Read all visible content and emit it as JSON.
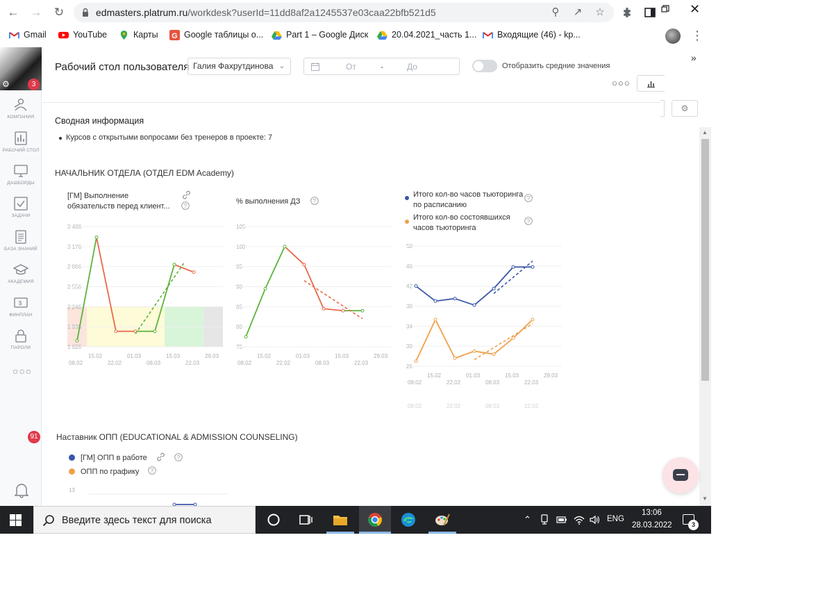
{
  "browser": {
    "url_host": "edmasters.platrum.ru",
    "url_path": "/workdesk?userId=11dd8af2a1245537e03caa22bfb521d5",
    "bookmarks": [
      {
        "label": "Gmail",
        "icon": "gmail-icon"
      },
      {
        "label": "YouTube",
        "icon": "youtube-icon"
      },
      {
        "label": "Карты",
        "icon": "maps-icon"
      },
      {
        "label": "Google таблицы о...",
        "icon": "sheets-icon"
      },
      {
        "label": "Part 1 – Google Диск",
        "icon": "drive-icon"
      },
      {
        "label": "20.04.2021_часть 1...",
        "icon": "drive-icon"
      },
      {
        "label": "Входящие (46) - kp...",
        "icon": "gmail-icon"
      }
    ]
  },
  "sidebar": {
    "avatar_badge": "3",
    "items": [
      {
        "label": "КОМПАНИЯ",
        "icon": "company-icon"
      },
      {
        "label": "РАБОЧИЙ СТОЛ",
        "icon": "workdesk-icon"
      },
      {
        "label": "ДАШБОРДЫ",
        "icon": "dashboard-icon"
      },
      {
        "label": "ЗАДАЧИ",
        "icon": "tasks-icon"
      },
      {
        "label": "БАЗА ЗНАНИЙ",
        "icon": "knowledge-icon"
      },
      {
        "label": "АКАДЕМИЯ",
        "icon": "academy-icon"
      },
      {
        "label": "ФИНПЛАН",
        "icon": "finplan-icon"
      },
      {
        "label": "ПАРОЛИ",
        "icon": "passwords-icon"
      }
    ],
    "notifications_count": "91"
  },
  "header": {
    "title": "Рабочий стол пользователя",
    "user_selected": "Галия Фахрутдинова",
    "date_from_placeholder": "От",
    "date_sep": "-",
    "date_to_placeholder": "До",
    "toggle_label": "Отобразить средние значения"
  },
  "summary": {
    "title": "Сводная информация",
    "item": "Курсов с открытыми вопросами без тренеров в проекте: 7"
  },
  "section1_title": "НАЧАЛЬНИК ОТДЕЛА (ОТДЕЛ EDM Academy)",
  "section2_title": "Наставник ОПП (EDUCATIONAL & ADMISSION COUNSELING)",
  "section2_legend": [
    "[ГМ] ОПП в работе",
    "ОПП по графику"
  ],
  "section2_tick": "13",
  "colors": {
    "green": "#5db33b",
    "red": "#e8694a",
    "blue": "#3a56a8",
    "orange": "#f0a04b",
    "band_green": "#d9f5d9",
    "band_yellow": "#fdfbd8",
    "band_red": "#fbe5dc",
    "band_gray": "#e6e6e6"
  },
  "chart_data": [
    {
      "type": "line",
      "title_lines": [
        "[ГМ] Выполнение",
        "обязательств перед клиент..."
      ],
      "x": [
        "08.02",
        "15.02",
        "22.02",
        "01.03",
        "08.03",
        "15.03",
        "22.03",
        "29.03"
      ],
      "x_ticks_upper": [
        "15.02",
        "01.03",
        "15.03",
        "29.03"
      ],
      "x_ticks_lower": [
        "08.02",
        "22.02",
        "08.03",
        "22.03"
      ],
      "y_ticks": [
        "3 486",
        "3 176",
        "2 866",
        "2 556",
        "2 246",
        "1 936",
        "1 626"
      ],
      "ylim": [
        1626,
        3486
      ],
      "values": [
        1720,
        3320,
        1865,
        1865,
        1865,
        2898,
        2780
      ],
      "trend": [
        [
          3,
          1826
        ],
        [
          5.5,
          2922
        ]
      ],
      "bands": [
        {
          "from": 1626,
          "to": 2246,
          "x0": -0.5,
          "x1": 0.5,
          "color": "band_red"
        },
        {
          "from": 1626,
          "to": 2246,
          "x0": 0.5,
          "x1": 2.5,
          "color": "band_yellow"
        },
        {
          "from": 1626,
          "to": 2246,
          "x0": 2.5,
          "x1": 4.5,
          "color": "band_yellow"
        },
        {
          "from": 1626,
          "to": 2246,
          "x0": 4.5,
          "x1": 6.5,
          "color": "band_green"
        },
        {
          "from": 1626,
          "to": 2246,
          "x0": 6.5,
          "x1": 7.5,
          "color": "band_gray"
        }
      ]
    },
    {
      "type": "line",
      "title_lines": [
        "% выполнения ДЗ"
      ],
      "x": [
        "08.02",
        "15.02",
        "22.02",
        "01.03",
        "08.03",
        "15.03",
        "22.03",
        "29.03"
      ],
      "x_ticks_upper": [
        "15.02",
        "01.03",
        "15.03",
        "29.03"
      ],
      "x_ticks_lower": [
        "08.02",
        "22.02",
        "08.03",
        "22.03"
      ],
      "y_ticks": [
        "105",
        "100",
        "95",
        "90",
        "85",
        "80",
        "75"
      ],
      "ylim": [
        75,
        105
      ],
      "values": [
        77.5,
        89.5,
        100,
        95.5,
        84.5,
        84,
        84
      ],
      "trend": [
        [
          3,
          91.5
        ],
        [
          6,
          82
        ]
      ]
    },
    {
      "type": "line",
      "series": [
        {
          "name": "Итого кол-во часов тьюторинга по расписанию",
          "values": [
            42,
            39,
            39.5,
            38.2,
            41.5,
            45.8,
            45.8
          ],
          "trend": [
            [
              4,
              40.5
            ],
            [
              6,
              47
            ]
          ]
        },
        {
          "name": "Итого кол-во состоявшихся часов тьюторинга",
          "values": [
            27,
            35.3,
            27.6,
            29,
            28.4,
            31.6,
            35.3
          ],
          "trend": [
            [
              3,
              27.3
            ],
            [
              6,
              34.5
            ]
          ]
        }
      ],
      "x": [
        "08.02",
        "15.02",
        "22.02",
        "01.03",
        "08.03",
        "15.03",
        "22.03",
        "29.03"
      ],
      "x_ticks_upper": [
        "15.02",
        "01.03",
        "15.03",
        "29.03"
      ],
      "x_ticks_lower": [
        "08.02",
        "22.02",
        "08.03",
        "22.03"
      ],
      "x_ticks_faded": [
        "08.02",
        "22.02",
        "08.03",
        "22.03"
      ],
      "y_ticks": [
        "50",
        "46",
        "42",
        "38",
        "34",
        "30",
        "26"
      ],
      "ylim": [
        26,
        50
      ]
    }
  ],
  "taskbar": {
    "search_placeholder": "Введите здесь текст для поиска",
    "lang": "ENG",
    "time": "13:06",
    "date": "28.03.2022",
    "notifications": "3"
  }
}
